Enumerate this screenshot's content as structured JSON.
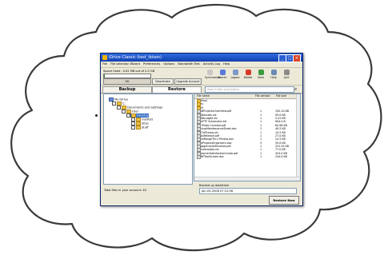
{
  "window": {
    "title": "iDrive Classic (test_ibison)"
  },
  "menu": [
    "File",
    "File selection Wizard",
    "Preferences",
    "Options",
    "Bandwidth Test",
    "Activity Log",
    "Help"
  ],
  "space": {
    "text": "Space Used : 0.02 MB out of 2.0 GB",
    "fraction": 0.01,
    "ok_label": "OK"
  },
  "buttons": {
    "deactivate": "Deactivate",
    "upgrade": "Upgrade Account"
  },
  "tools": [
    {
      "label": "Synchronize",
      "color": "#c8c8c8",
      "icon": "sync-icon"
    },
    {
      "label": "Search",
      "color": "#5a7ad8",
      "icon": "search-icon"
    },
    {
      "label": "Logout",
      "color": "#7a98c8",
      "icon": "logout-icon"
    },
    {
      "label": "Delete",
      "color": "#d83a2a",
      "icon": "delete-icon"
    },
    {
      "label": "Save",
      "color": "#3c9a3c",
      "icon": "save-icon"
    },
    {
      "label": "Help",
      "color": "#6a8ab8",
      "icon": "help-icon"
    },
    {
      "label": "Quit",
      "color": "#8a8a8a",
      "icon": "quit-icon"
    }
  ],
  "tabs": {
    "backup": "Backup",
    "restore": "Restore"
  },
  "search": {
    "placeholder": "Search files and folders"
  },
  "tree": [
    {
      "label": "My iDrive",
      "level": 0,
      "type": "root"
    },
    {
      "label": "C:",
      "level": 1,
      "type": "folder"
    },
    {
      "label": "Documents and Settings",
      "level": 2,
      "type": "folder"
    },
    {
      "label": "User",
      "level": 3,
      "type": "folder"
    },
    {
      "label": "Desktop",
      "level": 4,
      "type": "folder",
      "selected": true
    },
    {
      "label": "OutPost",
      "level": 5,
      "type": "folder"
    },
    {
      "label": "Sites",
      "level": 5,
      "type": "folder"
    },
    {
      "label": "Stuff",
      "level": 5,
      "type": "folder"
    }
  ],
  "list": {
    "headers": [
      "File name",
      "File version",
      "File size"
    ],
    "rows": [
      {
        "name": "OutPost",
        "version": "",
        "size": "",
        "folder": true
      },
      {
        "name": "Sites",
        "version": "",
        "size": "",
        "folder": true
      },
      {
        "name": "Stuff",
        "version": "",
        "size": "",
        "folder": true
      },
      {
        "name": "2008ProjectsOverView.pdf",
        "version": "1",
        "size": "192.10 KB",
        "folder": false
      },
      {
        "name": "2008assets.xls",
        "version": "1",
        "size": "95.0 KB",
        "folder": false
      },
      {
        "name": "2008budget.xls",
        "version": "1",
        "size": "5.41 KB",
        "folder": false
      },
      {
        "name": "ActePTF Schematic.bit",
        "version": "1",
        "size": "904.0 B",
        "folder": false
      },
      {
        "name": "AD Photo Concept.pdf",
        "version": "1",
        "size": "64.96 KB",
        "folder": false
      },
      {
        "name": "BackupMaintenanceSheet.doc",
        "version": "1",
        "size": "40.5 KB",
        "folder": false
      },
      {
        "name": "BMCWTcomp.xls",
        "version": "1",
        "size": "14.5 KB",
        "folder": false
      },
      {
        "name": "NewsRelease.pdf",
        "version": "1",
        "size": "27.0 KB",
        "folder": false
      },
      {
        "name": "DriveRangeThru Fitness.doc",
        "version": "1",
        "size": "24.5 KB",
        "folder": false
      },
      {
        "name": "EliteProjectsEngineers.doc",
        "version": "5",
        "size": "35.0 KB",
        "folder": false
      },
      {
        "name": "EngagementsFinished.pdf",
        "version": "1",
        "size": "231.50 KB",
        "folder": false
      },
      {
        "name": "foundersdata.xls",
        "version": "1",
        "size": "77.0 KB",
        "folder": false
      },
      {
        "name": "CustomerSatisfactionGuide.pdf",
        "version": "1",
        "size": "425.0 KB",
        "folder": false
      },
      {
        "name": "SNMPToolScreen.doc",
        "version": "1",
        "size": "244.0 KB",
        "folder": false
      }
    ]
  },
  "footer": {
    "total": "Total files in your account: 40",
    "backed_up_label": "Backed up date/time",
    "backed_up_value": "Jan-03-2008 07:31:06",
    "restore_button": "Restore Now"
  }
}
